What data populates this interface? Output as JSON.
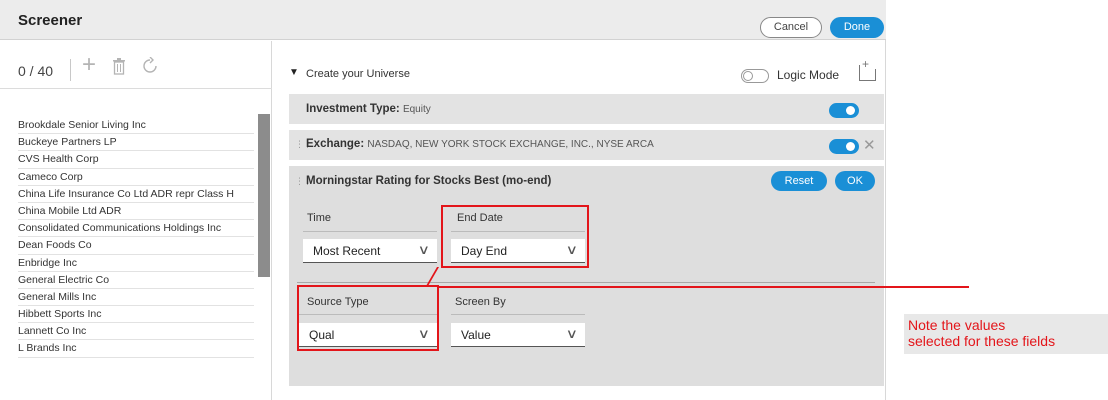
{
  "header": {
    "title": "Screener",
    "cancel_label": "Cancel",
    "done_label": "Done"
  },
  "left_panel": {
    "count": "0 / 40",
    "toolbar_icons": [
      "plus-icon",
      "trash-icon",
      "refresh-icon"
    ],
    "items": [
      "Brookdale Senior Living Inc",
      "Buckeye Partners LP",
      "CVS Health Corp",
      "Cameco Corp",
      "China Life Insurance Co Ltd ADR repr Class H",
      "China Mobile Ltd ADR",
      "Consolidated Communications Holdings Inc",
      "Dean Foods Co",
      "Enbridge Inc",
      "General Electric Co",
      "General Mills Inc",
      "Hibbett Sports Inc",
      "Lannett Co Inc",
      "L Brands Inc"
    ]
  },
  "universe": {
    "title": "Create your Universe",
    "logic_mode_label": "Logic Mode"
  },
  "rows": {
    "investment_type": {
      "label": "Investment Type:",
      "value": "Equity"
    },
    "exchange": {
      "label": "Exchange:",
      "value": "NASDAQ, NEW YORK STOCK EXCHANGE, INC., NYSE ARCA"
    }
  },
  "criteria": {
    "title": "Morningstar Rating for Stocks Best (mo-end)",
    "reset_label": "Reset",
    "ok_label": "OK",
    "fields": {
      "time": {
        "label": "Time",
        "value": "Most Recent"
      },
      "end_date": {
        "label": "End Date",
        "value": "Day End"
      },
      "source_type": {
        "label": "Source Type",
        "value": "Qual"
      },
      "screen_by": {
        "label": "Screen By",
        "value": "Value"
      }
    }
  },
  "annotation": {
    "line1": "Note the values",
    "line2": "selected for these fields"
  },
  "colors": {
    "accent": "#1a8fd6",
    "annotation": "#e3151a"
  }
}
